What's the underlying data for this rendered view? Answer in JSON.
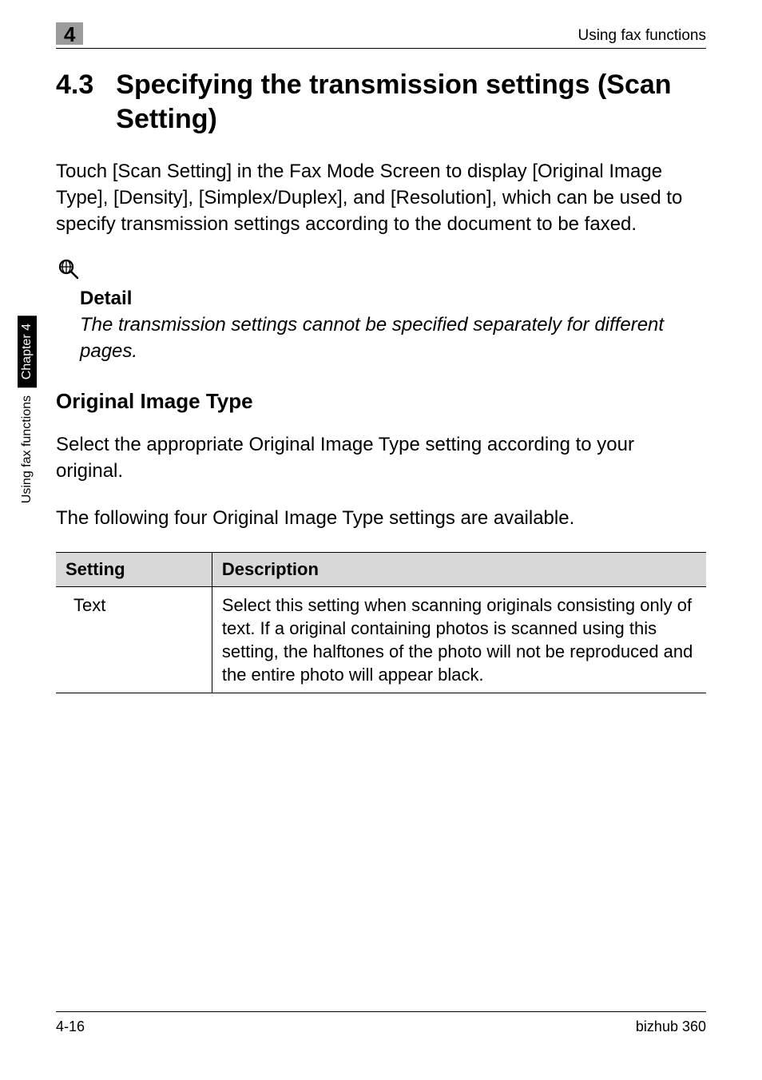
{
  "header": {
    "chapter_num": "4",
    "running_title": "Using fax functions"
  },
  "section": {
    "number": "4.3",
    "title": "Specifying the transmission settings (Scan Setting)"
  },
  "intro_paragraph": "Touch [Scan Setting] in the Fax Mode Screen to display [Original Image Type], [Density], [Simplex/Duplex], and [Resolution], which can be used to specify transmission settings according to the document to be faxed.",
  "detail": {
    "icon_name": "magnifying-glass-icon",
    "label": "Detail",
    "text": "The transmission settings cannot be specified separately for different pages."
  },
  "subsection": {
    "heading": "Original Image Type",
    "para1": "Select the appropriate Original Image Type setting according to your original.",
    "para2": "The following four Original Image Type settings are available."
  },
  "table": {
    "headers": {
      "setting": "Setting",
      "description": "Description"
    },
    "rows": [
      {
        "setting": "Text",
        "description": "Select this setting when scanning originals consisting only of text. If a original containing photos is scanned using this setting, the halftones of the photo will not be reproduced and the entire photo will appear black."
      }
    ]
  },
  "side_tab": {
    "chapter": "Chapter 4",
    "label": "Using fax functions"
  },
  "footer": {
    "page_num": "4-16",
    "product": "bizhub 360"
  }
}
